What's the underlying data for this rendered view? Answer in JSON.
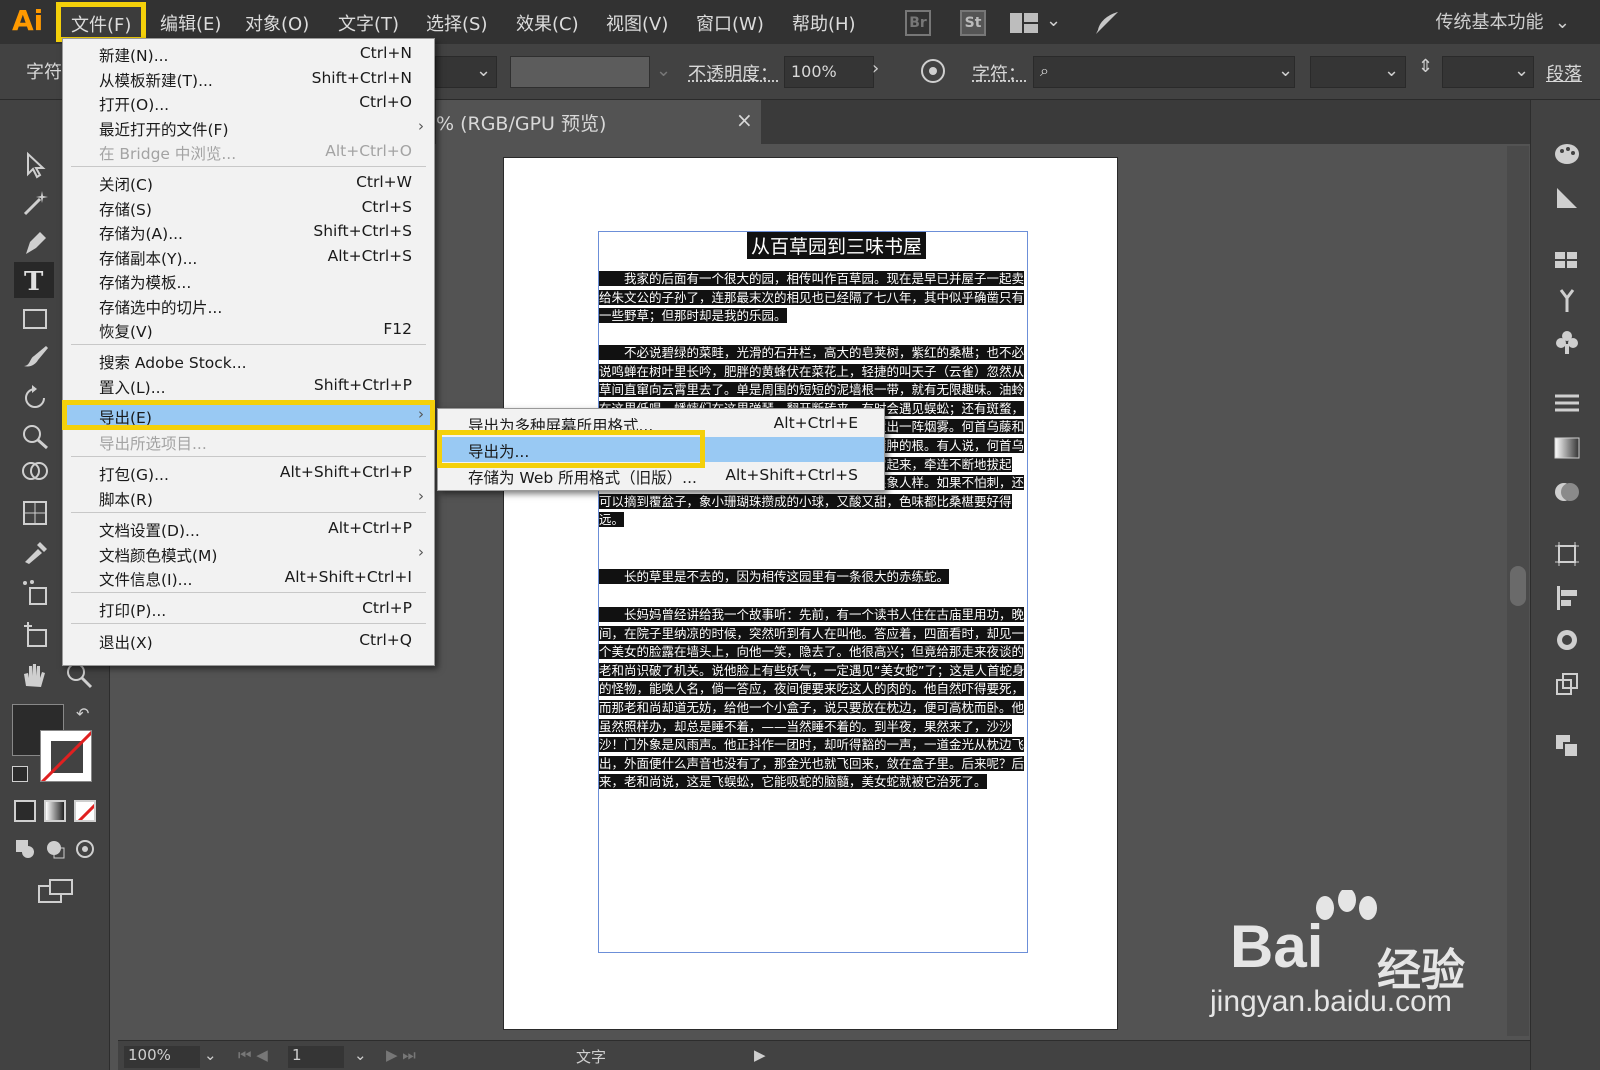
{
  "app": {
    "logo": "Ai",
    "workspace": "传统基本功能"
  },
  "menubar": [
    "文件(F)",
    "编辑(E)",
    "对象(O)",
    "文字(T)",
    "选择(S)",
    "效果(C)",
    "视图(V)",
    "窗口(W)",
    "帮助(H)"
  ],
  "badges": {
    "br": "Br",
    "st": "St"
  },
  "control": {
    "char_label": "字符",
    "opacity_label": "不透明度：",
    "opacity_value": "100%",
    "char_label2": "字符：",
    "para_label": "段落"
  },
  "document_tab": {
    "title": "% (RGB/GPU 预览)",
    "close": "×"
  },
  "file_menu": [
    {
      "label": "新建(N)...",
      "shortcut": "Ctrl+N"
    },
    {
      "label": "从模板新建(T)...",
      "shortcut": "Shift+Ctrl+N"
    },
    {
      "label": "打开(O)...",
      "shortcut": "Ctrl+O"
    },
    {
      "label": "最近打开的文件(F)",
      "shortcut": "",
      "submenu": true
    },
    {
      "label": "在 Bridge 中浏览...",
      "shortcut": "Alt+Ctrl+O",
      "disabled": true
    },
    {
      "label": "关闭(C)",
      "shortcut": "Ctrl+W"
    },
    {
      "label": "存储(S)",
      "shortcut": "Ctrl+S"
    },
    {
      "label": "存储为(A)...",
      "shortcut": "Shift+Ctrl+S"
    },
    {
      "label": "存储副本(Y)...",
      "shortcut": "Alt+Ctrl+S"
    },
    {
      "label": "存储为模板...",
      "shortcut": ""
    },
    {
      "label": "存储选中的切片...",
      "shortcut": ""
    },
    {
      "label": "恢复(V)",
      "shortcut": "F12"
    },
    {
      "label": "搜索 Adobe Stock...",
      "shortcut": ""
    },
    {
      "label": "置入(L)...",
      "shortcut": "Shift+Ctrl+P"
    },
    {
      "label": "导出(E)",
      "shortcut": "",
      "submenu": true,
      "highlight": true
    },
    {
      "label": "导出所选项目...",
      "shortcut": "",
      "disabled": true
    },
    {
      "label": "打包(G)...",
      "shortcut": "Alt+Shift+Ctrl+P"
    },
    {
      "label": "脚本(R)",
      "shortcut": "",
      "submenu": true
    },
    {
      "label": "文档设置(D)...",
      "shortcut": "Alt+Ctrl+P"
    },
    {
      "label": "文档颜色模式(M)",
      "shortcut": "",
      "submenu": true
    },
    {
      "label": "文件信息(I)...",
      "shortcut": "Alt+Shift+Ctrl+I"
    },
    {
      "label": "打印(P)...",
      "shortcut": "Ctrl+P"
    },
    {
      "label": "退出(X)",
      "shortcut": "Ctrl+Q"
    }
  ],
  "export_submenu": [
    {
      "label": "导出为多种屏幕所用格式...",
      "shortcut": "Alt+Ctrl+E"
    },
    {
      "label": "导出为...",
      "shortcut": "",
      "highlight": true
    },
    {
      "label": "存储为 Web 所用格式（旧版）...",
      "shortcut": "Alt+Shift+Ctrl+S"
    }
  ],
  "artboard": {
    "title": "从百草园到三味书屋",
    "paragraphs": [
      "　　我家的后面有一个很大的园，相传叫作百草园。现在是早已并屋子一起卖给朱文公的子孙了，连那最末次的相见也已经隔了七八年，其中似乎确凿只有一些野草；但那时却是我的乐园。",
      "　　不必说碧绿的菜畦，光滑的石井栏，高大的皂荚树，紫红的桑椹；也不必说鸣蝉在树叶里长吟，肥胖的黄蜂伏在菜花上，轻捷的叫天子（云雀）忽然从草间直窜向云霄里去了。单是周围的短短的泥墙根一带，就有无限趣味。油蛉在这里低唱，蟋蟀们在这里弹琴。翻开断砖来，有时会遇见蜈蚣；还有斑蝥，倘若用手指按住它的脊梁，便会啪的一声，从后窍喷出一阵烟雾。何首乌藤和木莲藤缠络着，木莲有莲房一般的果实，何首乌有臃肿的根。有人说，何首乌根是有象人形的，吃了便可以成仙，我于是常常拔它起来，牵连不断地拔起来，也曾因此弄坏了泥墙，却从来没有见过有一块根象人样。如果不怕刺，还可以摘到覆盆子，象小珊瑚珠攒成的小球，又酸又甜，色味都比桑椹要好得远。",
      "　　长的草里是不去的，因为相传这园里有一条很大的赤练蛇。",
      "　　长妈妈曾经讲给我一个故事听：先前，有一个读书人住在古庙里用功，晚间，在院子里纳凉的时候，突然听到有人在叫他。答应着，四面看时，却见一个美女的脸露在墙头上，向他一笑，隐去了。他很高兴；但竟给那走来夜谈的老和尚识破了机关。说他脸上有些妖气，一定遇见“美女蛇”了；这是人首蛇身的怪物，能唤人名，倘一答应，夜间便要来吃这人的肉的。他自然吓得要死，而那老和尚却道无妨，给他一个小盒子，说只要放在枕边，便可高枕而卧。他虽然照样办，却总是睡不着，——当然睡不着的。到半夜，果然来了，沙沙沙！门外象是风雨声。他正抖作一团时，却听得豁的一声，一道金光从枕边飞出，外面便什么声音也没有了，那金光也就飞回来，敛在盒子里。后来呢？后来，老和尚说，这是飞蜈蚣，它能吸蛇的脑髓，美女蛇就被它治死了。"
    ]
  },
  "status": {
    "zoom": "100%",
    "page": "1",
    "tool": "文字"
  },
  "watermark": {
    "brand": "Bai",
    "brand2": "经验",
    "url": "jingyan.baidu.com"
  }
}
